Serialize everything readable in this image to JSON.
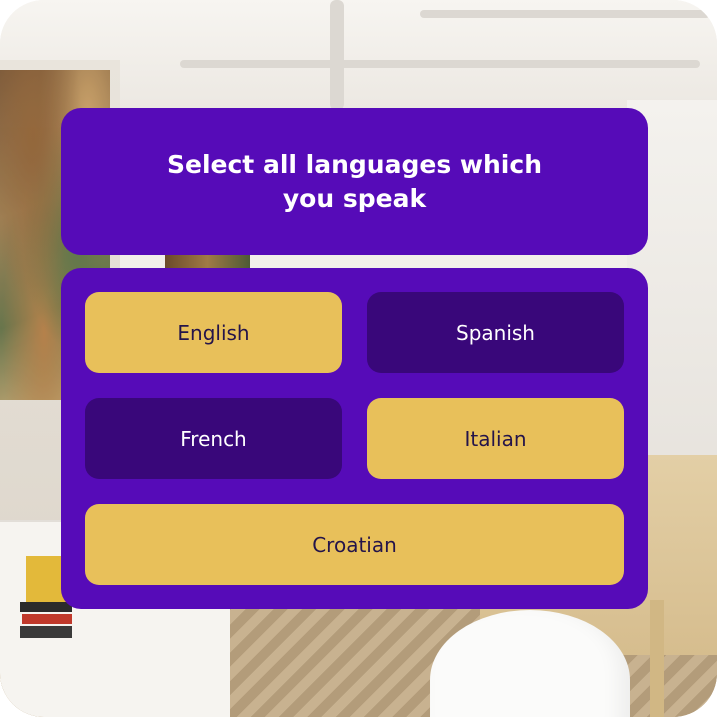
{
  "question": {
    "text": "Select all languages which you speak"
  },
  "options": [
    {
      "label": "English",
      "selected": true
    },
    {
      "label": "Spanish",
      "selected": false
    },
    {
      "label": "French",
      "selected": false
    },
    {
      "label": "Italian",
      "selected": true
    },
    {
      "label": "Croatian",
      "selected": true
    }
  ],
  "colors": {
    "card_background": "#560bb8",
    "option_selected": "#e8c05a",
    "option_unselected": "#39077a"
  }
}
